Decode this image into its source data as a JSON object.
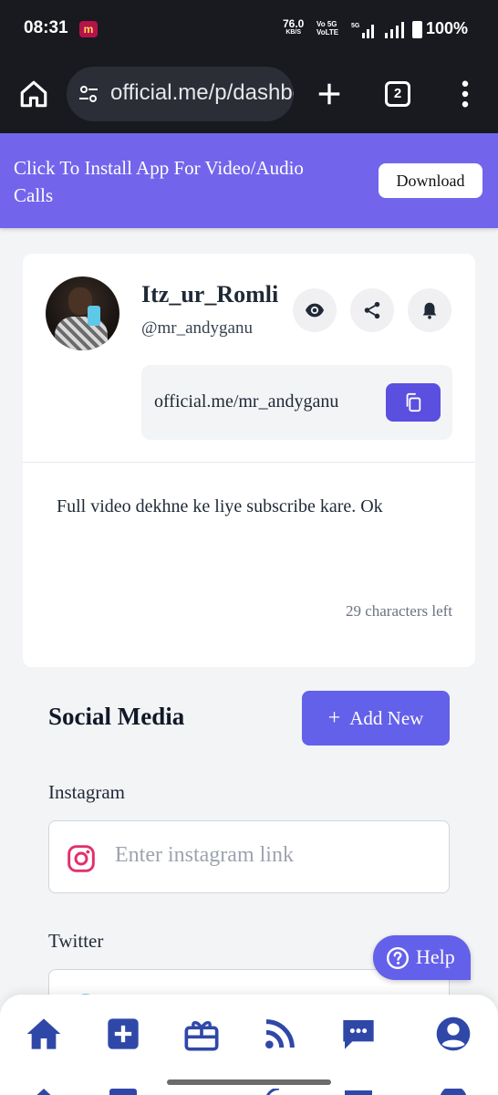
{
  "status_bar": {
    "time": "08:31",
    "app_badge": "m",
    "net_speed": "76.0",
    "net_unit": "KB/S",
    "volte_top": "Vo 5G",
    "volte_bottom": "VoLTE",
    "battery": "100%"
  },
  "browser": {
    "url": "official.me/p/dashboard",
    "tab_count": "2"
  },
  "install_banner": {
    "text": "Click To Install App For Video/Audio Calls",
    "button": "Download"
  },
  "profile": {
    "display_name": "Itz_ur_Romli",
    "username": "@mr_andyganu",
    "profile_link": "official.me/mr_andyganu",
    "bio": "Full video dekhne ke liye subscribe kare. Ok",
    "chars_left": "29 characters left"
  },
  "social": {
    "title": "Social Media",
    "add_button": "Add New",
    "add_button_icon": "+",
    "fields": [
      {
        "label": "Instagram",
        "placeholder": "Enter instagram link"
      },
      {
        "label": "Twitter"
      }
    ]
  },
  "help": {
    "label": "Help"
  },
  "bottom_nav": {
    "icons": [
      "home-icon",
      "add-square-icon",
      "gift-card-icon",
      "rss-icon",
      "chat-icon",
      "account-icon"
    ]
  },
  "colors": {
    "accent": "#6360ea",
    "banner": "#7265ec",
    "nav_icon": "#2f48a8",
    "instagram": "#e1306c"
  }
}
